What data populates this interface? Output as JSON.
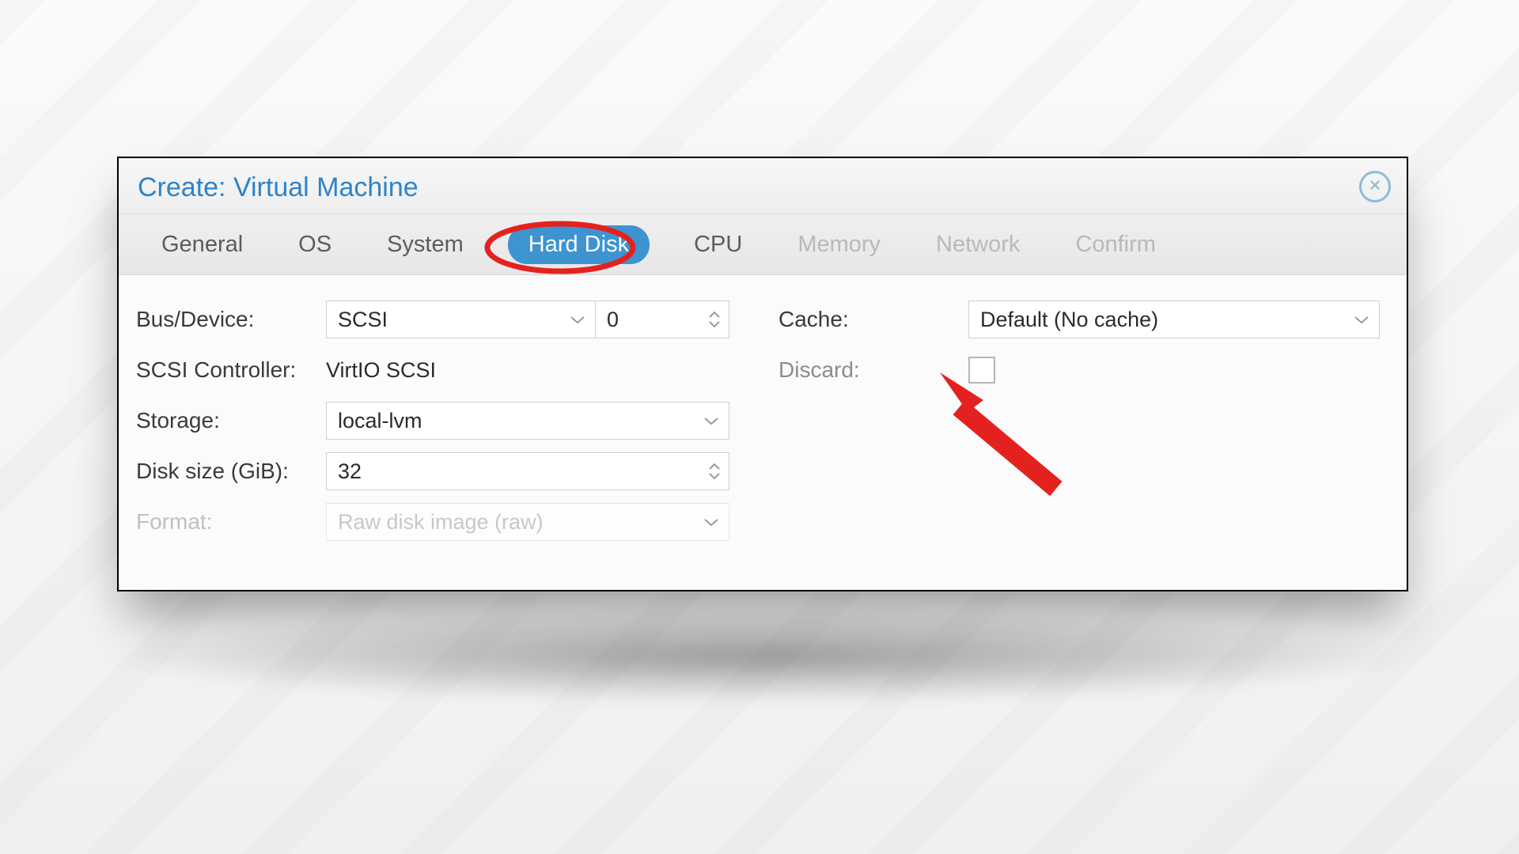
{
  "dialog": {
    "title": "Create: Virtual Machine"
  },
  "tabs": [
    {
      "label": "General",
      "state": "enabled"
    },
    {
      "label": "OS",
      "state": "enabled"
    },
    {
      "label": "System",
      "state": "enabled"
    },
    {
      "label": "Hard Disk",
      "state": "active"
    },
    {
      "label": "CPU",
      "state": "enabled"
    },
    {
      "label": "Memory",
      "state": "disabled"
    },
    {
      "label": "Network",
      "state": "disabled"
    },
    {
      "label": "Confirm",
      "state": "disabled"
    }
  ],
  "left": {
    "bus_device_label": "Bus/Device:",
    "bus_value": "SCSI",
    "device_index": "0",
    "scsi_controller_label": "SCSI Controller:",
    "scsi_controller_value": "VirtIO SCSI",
    "storage_label": "Storage:",
    "storage_value": "local-lvm",
    "disk_size_label": "Disk size (GiB):",
    "disk_size_value": "32",
    "format_label": "Format:",
    "format_value": "Raw disk image (raw)"
  },
  "right": {
    "cache_label": "Cache:",
    "cache_value": "Default (No cache)",
    "discard_label": "Discard:",
    "discard_checked": false
  },
  "annotations": {
    "active_tab_circled": true,
    "arrow_points_to": "discard-checkbox"
  }
}
